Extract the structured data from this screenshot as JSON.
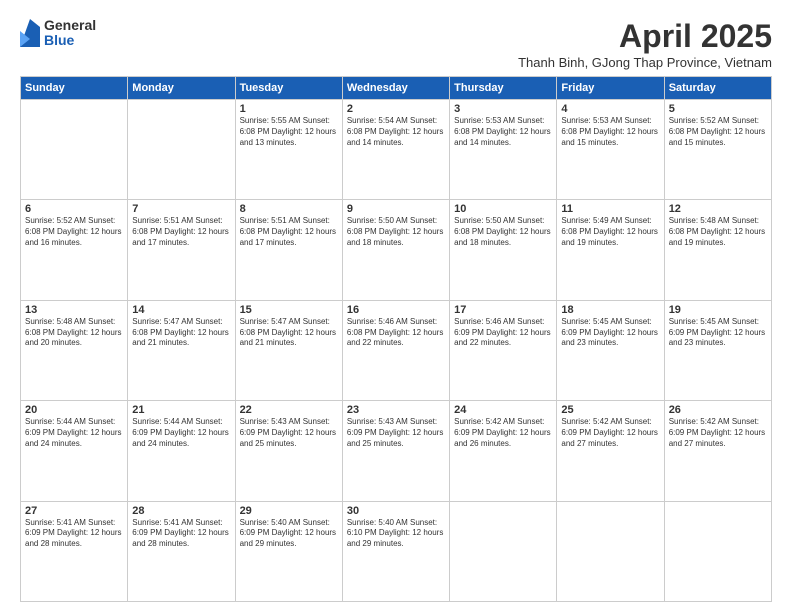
{
  "logo": {
    "general": "General",
    "blue": "Blue"
  },
  "header": {
    "title": "April 2025",
    "subtitle": "Thanh Binh, GJong Thap Province, Vietnam"
  },
  "days_of_week": [
    "Sunday",
    "Monday",
    "Tuesday",
    "Wednesday",
    "Thursday",
    "Friday",
    "Saturday"
  ],
  "weeks": [
    [
      {
        "day": "",
        "info": ""
      },
      {
        "day": "",
        "info": ""
      },
      {
        "day": "1",
        "info": "Sunrise: 5:55 AM\nSunset: 6:08 PM\nDaylight: 12 hours and 13 minutes."
      },
      {
        "day": "2",
        "info": "Sunrise: 5:54 AM\nSunset: 6:08 PM\nDaylight: 12 hours and 14 minutes."
      },
      {
        "day": "3",
        "info": "Sunrise: 5:53 AM\nSunset: 6:08 PM\nDaylight: 12 hours and 14 minutes."
      },
      {
        "day": "4",
        "info": "Sunrise: 5:53 AM\nSunset: 6:08 PM\nDaylight: 12 hours and 15 minutes."
      },
      {
        "day": "5",
        "info": "Sunrise: 5:52 AM\nSunset: 6:08 PM\nDaylight: 12 hours and 15 minutes."
      }
    ],
    [
      {
        "day": "6",
        "info": "Sunrise: 5:52 AM\nSunset: 6:08 PM\nDaylight: 12 hours and 16 minutes."
      },
      {
        "day": "7",
        "info": "Sunrise: 5:51 AM\nSunset: 6:08 PM\nDaylight: 12 hours and 17 minutes."
      },
      {
        "day": "8",
        "info": "Sunrise: 5:51 AM\nSunset: 6:08 PM\nDaylight: 12 hours and 17 minutes."
      },
      {
        "day": "9",
        "info": "Sunrise: 5:50 AM\nSunset: 6:08 PM\nDaylight: 12 hours and 18 minutes."
      },
      {
        "day": "10",
        "info": "Sunrise: 5:50 AM\nSunset: 6:08 PM\nDaylight: 12 hours and 18 minutes."
      },
      {
        "day": "11",
        "info": "Sunrise: 5:49 AM\nSunset: 6:08 PM\nDaylight: 12 hours and 19 minutes."
      },
      {
        "day": "12",
        "info": "Sunrise: 5:48 AM\nSunset: 6:08 PM\nDaylight: 12 hours and 19 minutes."
      }
    ],
    [
      {
        "day": "13",
        "info": "Sunrise: 5:48 AM\nSunset: 6:08 PM\nDaylight: 12 hours and 20 minutes."
      },
      {
        "day": "14",
        "info": "Sunrise: 5:47 AM\nSunset: 6:08 PM\nDaylight: 12 hours and 21 minutes."
      },
      {
        "day": "15",
        "info": "Sunrise: 5:47 AM\nSunset: 6:08 PM\nDaylight: 12 hours and 21 minutes."
      },
      {
        "day": "16",
        "info": "Sunrise: 5:46 AM\nSunset: 6:08 PM\nDaylight: 12 hours and 22 minutes."
      },
      {
        "day": "17",
        "info": "Sunrise: 5:46 AM\nSunset: 6:09 PM\nDaylight: 12 hours and 22 minutes."
      },
      {
        "day": "18",
        "info": "Sunrise: 5:45 AM\nSunset: 6:09 PM\nDaylight: 12 hours and 23 minutes."
      },
      {
        "day": "19",
        "info": "Sunrise: 5:45 AM\nSunset: 6:09 PM\nDaylight: 12 hours and 23 minutes."
      }
    ],
    [
      {
        "day": "20",
        "info": "Sunrise: 5:44 AM\nSunset: 6:09 PM\nDaylight: 12 hours and 24 minutes."
      },
      {
        "day": "21",
        "info": "Sunrise: 5:44 AM\nSunset: 6:09 PM\nDaylight: 12 hours and 24 minutes."
      },
      {
        "day": "22",
        "info": "Sunrise: 5:43 AM\nSunset: 6:09 PM\nDaylight: 12 hours and 25 minutes."
      },
      {
        "day": "23",
        "info": "Sunrise: 5:43 AM\nSunset: 6:09 PM\nDaylight: 12 hours and 25 minutes."
      },
      {
        "day": "24",
        "info": "Sunrise: 5:42 AM\nSunset: 6:09 PM\nDaylight: 12 hours and 26 minutes."
      },
      {
        "day": "25",
        "info": "Sunrise: 5:42 AM\nSunset: 6:09 PM\nDaylight: 12 hours and 27 minutes."
      },
      {
        "day": "26",
        "info": "Sunrise: 5:42 AM\nSunset: 6:09 PM\nDaylight: 12 hours and 27 minutes."
      }
    ],
    [
      {
        "day": "27",
        "info": "Sunrise: 5:41 AM\nSunset: 6:09 PM\nDaylight: 12 hours and 28 minutes."
      },
      {
        "day": "28",
        "info": "Sunrise: 5:41 AM\nSunset: 6:09 PM\nDaylight: 12 hours and 28 minutes."
      },
      {
        "day": "29",
        "info": "Sunrise: 5:40 AM\nSunset: 6:09 PM\nDaylight: 12 hours and 29 minutes."
      },
      {
        "day": "30",
        "info": "Sunrise: 5:40 AM\nSunset: 6:10 PM\nDaylight: 12 hours and 29 minutes."
      },
      {
        "day": "",
        "info": ""
      },
      {
        "day": "",
        "info": ""
      },
      {
        "day": "",
        "info": ""
      }
    ]
  ]
}
